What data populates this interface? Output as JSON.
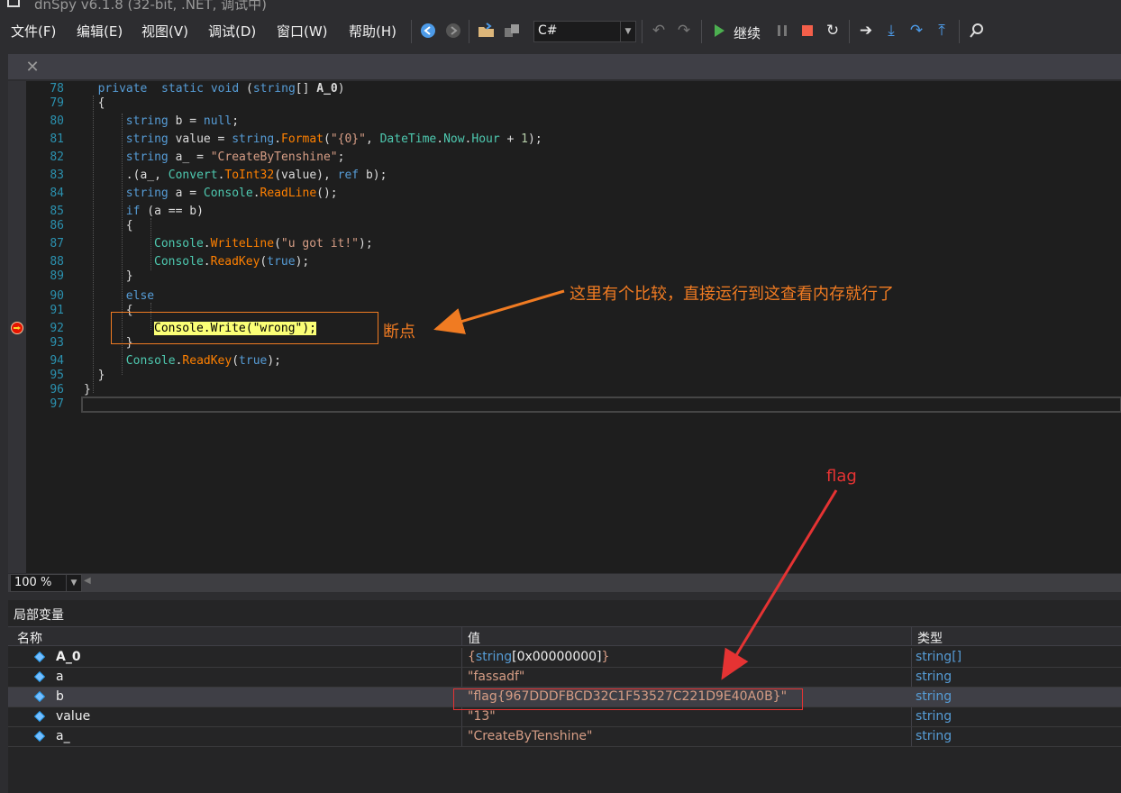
{
  "window": {
    "title": "dnSpy v6.1.8 (32-bit, .NET, 调试中)"
  },
  "menu": [
    "文件(F)",
    "编辑(E)",
    "视图(V)",
    "调试(D)",
    "窗口(W)",
    "帮助(H)"
  ],
  "toolbar": {
    "language": "C#",
    "continue_label": "继续",
    "icons": [
      "back-icon",
      "forward-icon",
      "open-icon",
      "open-list-icon",
      "undo-icon",
      "redo-icon",
      "continue-icon",
      "pause-icon",
      "stop-icon",
      "restart-icon",
      "show-next-statement-icon",
      "step-into-icon",
      "step-over-icon",
      "step-out-icon",
      "search-icon"
    ],
    "colors": {
      "continue": "#4caf50",
      "stop": "#f35f4a",
      "nav": "#4d9be8"
    }
  },
  "tab": {
    "close": "✕"
  },
  "code": {
    "lines": [
      {
        "n": "78",
        "tokens": [
          [
            "k",
            "private"
          ],
          [
            "",
            "  "
          ],
          [
            "k",
            "static"
          ],
          [
            "",
            " "
          ],
          [
            "k",
            "void"
          ],
          [
            "",
            " ("
          ],
          [
            "k",
            "string"
          ],
          [
            "",
            "[] "
          ],
          [
            "b",
            "A_0"
          ],
          [
            "",
            ")"
          ]
        ]
      },
      {
        "n": "79",
        "tokens": [
          [
            "",
            "{"
          ]
        ]
      },
      {
        "n": "80",
        "tokens": [
          [
            "k",
            "string"
          ],
          [
            "",
            " b = "
          ],
          [
            "k",
            "null"
          ],
          [
            "",
            ";"
          ]
        ]
      },
      {
        "n": "81",
        "tokens": [
          [
            "k",
            "string"
          ],
          [
            "",
            " value = "
          ],
          [
            "k",
            "string"
          ],
          [
            "",
            "."
          ],
          [
            "m",
            "Format"
          ],
          [
            "",
            "("
          ],
          [
            "s",
            "\"{0}\""
          ],
          [
            "",
            ", "
          ],
          [
            "t",
            "DateTime"
          ],
          [
            "",
            "."
          ],
          [
            "t",
            "Now"
          ],
          [
            "",
            "."
          ],
          [
            "t",
            "Hour"
          ],
          [
            "",
            " + "
          ],
          [
            "n",
            "1"
          ],
          [
            "",
            ");"
          ]
        ]
      },
      {
        "n": "82",
        "tokens": [
          [
            "k",
            "string"
          ],
          [
            "",
            " a_ = "
          ],
          [
            "s",
            "\"CreateByTenshine\""
          ],
          [
            "",
            ";"
          ]
        ]
      },
      {
        "n": "83",
        "tokens": [
          [
            "",
            ".(a_, "
          ],
          [
            "t",
            "Convert"
          ],
          [
            "",
            "."
          ],
          [
            "m",
            "ToInt32"
          ],
          [
            "",
            "(value), "
          ],
          [
            "k",
            "ref"
          ],
          [
            "",
            " b);"
          ]
        ]
      },
      {
        "n": "84",
        "tokens": [
          [
            "k",
            "string"
          ],
          [
            "",
            " a = "
          ],
          [
            "t",
            "Console"
          ],
          [
            "",
            "."
          ],
          [
            "m",
            "ReadLine"
          ],
          [
            "",
            "();"
          ]
        ]
      },
      {
        "n": "85",
        "tokens": [
          [
            "k",
            "if"
          ],
          [
            "",
            " (a == b)"
          ]
        ]
      },
      {
        "n": "86",
        "tokens": [
          [
            "",
            "{"
          ]
        ]
      },
      {
        "n": "87",
        "tokens": [
          [
            "t",
            "Console"
          ],
          [
            "",
            "."
          ],
          [
            "m",
            "WriteLine"
          ],
          [
            "",
            "("
          ],
          [
            "s",
            "\"u got it!\""
          ],
          [
            "",
            ");"
          ]
        ]
      },
      {
        "n": "88",
        "tokens": [
          [
            "t",
            "Console"
          ],
          [
            "",
            "."
          ],
          [
            "m",
            "ReadKey"
          ],
          [
            "",
            "("
          ],
          [
            "k",
            "true"
          ],
          [
            "",
            ");"
          ]
        ]
      },
      {
        "n": "89",
        "tokens": [
          [
            "",
            "}"
          ]
        ]
      },
      {
        "n": "90",
        "tokens": [
          [
            "k",
            "else"
          ]
        ]
      },
      {
        "n": "91",
        "tokens": [
          [
            "",
            "{"
          ]
        ]
      },
      {
        "n": "92",
        "tokens": [
          [
            "h",
            "Console.Write(\"wrong\");"
          ]
        ]
      },
      {
        "n": "93",
        "tokens": [
          [
            "",
            "}"
          ]
        ]
      },
      {
        "n": "94",
        "tokens": [
          [
            "t",
            "Console"
          ],
          [
            "",
            "."
          ],
          [
            "m",
            "ReadKey"
          ],
          [
            "",
            "("
          ],
          [
            "k",
            "true"
          ],
          [
            "",
            ");"
          ]
        ]
      },
      {
        "n": "95",
        "tokens": [
          [
            "",
            "}"
          ]
        ]
      },
      {
        "n": "96",
        "tokens": [
          [
            "",
            "}"
          ]
        ]
      },
      {
        "n": "97",
        "tokens": []
      }
    ]
  },
  "annotations": {
    "breakpoint_label": "断点",
    "comparison_note": "这里有个比较，直接运行到这查看内存就行了",
    "flag_label": "flag",
    "colors": {
      "orange": "#f07b22",
      "red": "#e53333"
    }
  },
  "zoom": {
    "value": "100 %"
  },
  "locals": {
    "title": "局部变量",
    "headers": {
      "name": "名称",
      "value": "值",
      "type": "类型"
    },
    "rows": [
      {
        "name": "A_0",
        "value_parts": [
          "{",
          "string",
          "[0x00000000]",
          "}"
        ],
        "value": "{string[0x00000000]}",
        "type": "string[]",
        "bold": true
      },
      {
        "name": "a",
        "value": "\"fassadf\"",
        "type": "string"
      },
      {
        "name": "b",
        "value": "\"flag{967DDDFBCD32C1F53527C221D9E40A0B}\"",
        "type": "string",
        "selected": true
      },
      {
        "name": "value",
        "value": "\"13\"",
        "type": "string"
      },
      {
        "name": "a_",
        "value": "\"CreateByTenshine\"",
        "type": "string"
      }
    ]
  }
}
